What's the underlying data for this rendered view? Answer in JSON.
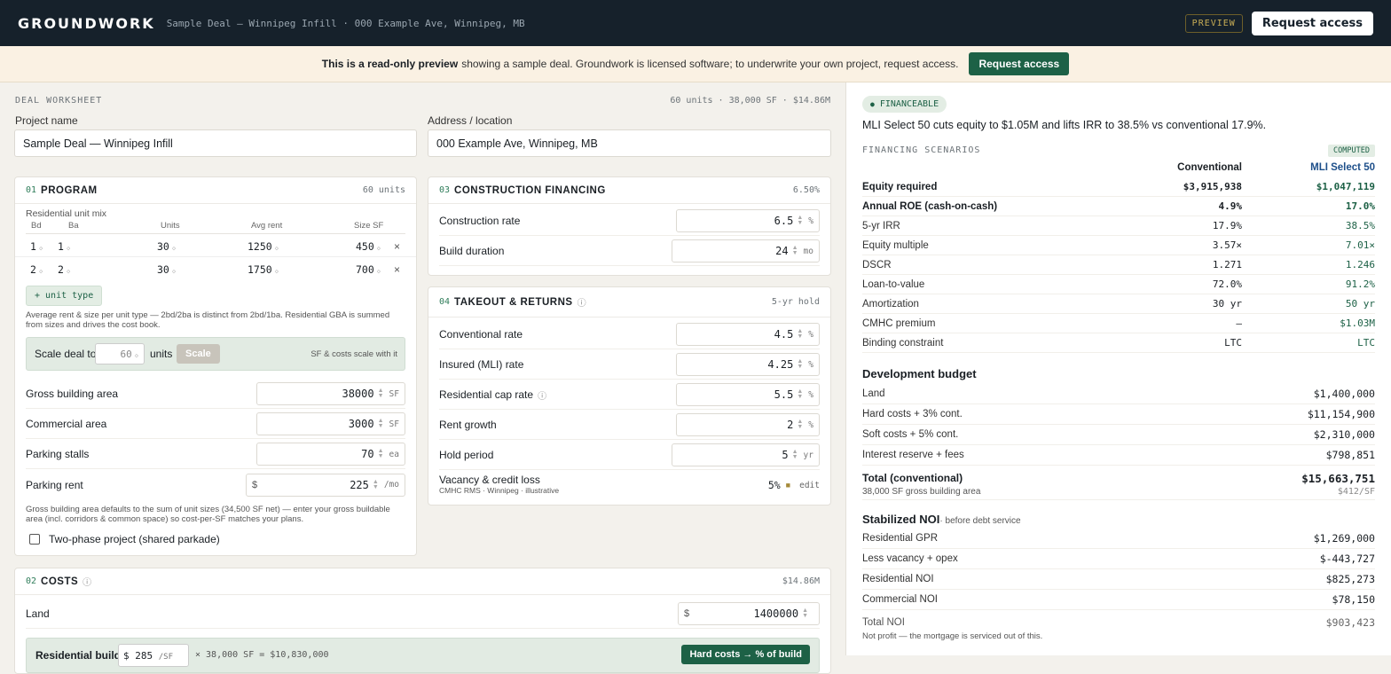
{
  "header": {
    "brand": "GROUNDWORK",
    "breadcrumb": "Sample Deal — Winnipeg Infill · 000 Example Ave, Winnipeg, MB",
    "preview_badge": "PREVIEW",
    "request_label": "Request access"
  },
  "banner": {
    "bold": "This is a read-only preview",
    "text": "showing a sample deal. Groundwork is licensed software; to underwrite your own project, request access.",
    "button": "Request access"
  },
  "worksheet": {
    "label": "DEAL WORKSHEET",
    "summary": "60 units · 38,000 SF · $14.86M",
    "project_label": "Project name",
    "project_value": "Sample Deal — Winnipeg Infill",
    "address_label": "Address / location",
    "address_value": "000 Example Ave, Winnipeg, MB"
  },
  "program": {
    "num": "01",
    "title": "PROGRAM",
    "meta": "60 units",
    "mix_label": "Residential unit mix",
    "col_bd": "Bd",
    "col_ba": "Ba",
    "col_units": "Units",
    "col_rent": "Avg rent",
    "col_size": "Size SF",
    "rows": [
      {
        "bd": "1",
        "ba": "1",
        "units": "30",
        "rent": "1250",
        "size": "450"
      },
      {
        "bd": "2",
        "ba": "2",
        "units": "30",
        "rent": "1750",
        "size": "700"
      }
    ],
    "add_unit": "+ unit type",
    "mix_note": "Average rent & size per unit type — 2bd/2ba is distinct from 2bd/1ba. Residential GBA is summed from sizes and drives the cost book.",
    "scale_label": "Scale deal to",
    "scale_value": "60",
    "scale_units": "units",
    "scale_button": "Scale",
    "scale_note": "SF & costs scale with it",
    "gba_label": "Gross building area",
    "gba_value": "38000",
    "gba_unit": "SF",
    "comm_label": "Commercial area",
    "comm_value": "3000",
    "comm_unit": "SF",
    "parking_label": "Parking stalls",
    "parking_value": "70",
    "parking_unit": "ea",
    "prent_label": "Parking rent",
    "prent_prefix": "$",
    "prent_value": "225",
    "prent_unit": "/mo",
    "gba_note": "Gross building area defaults to the sum of unit sizes (34,500 SF net) — enter your gross buildable area (incl. corridors & common space) so cost-per-SF matches your plans.",
    "two_phase": "Two-phase project (shared parkade)"
  },
  "construction": {
    "num": "03",
    "title": "CONSTRUCTION FINANCING",
    "meta": "6.50%",
    "rate_label": "Construction rate",
    "rate_value": "6.5",
    "rate_unit": "%",
    "dur_label": "Build duration",
    "dur_value": "24",
    "dur_unit": "mo"
  },
  "takeout": {
    "num": "04",
    "title": "TAKEOUT & RETURNS",
    "meta": "5-yr hold",
    "conv_label": "Conventional rate",
    "conv_value": "4.5",
    "mli_label": "Insured (MLI) rate",
    "mli_value": "4.25",
    "cap_label": "Residential cap rate",
    "cap_value": "5.5",
    "growth_label": "Rent growth",
    "growth_value": "2",
    "hold_label": "Hold period",
    "hold_value": "5",
    "hold_unit": "yr",
    "pct": "%",
    "vac_label": "Vacancy & credit loss",
    "vac_sub": "CMHC RMS · Winnipeg · illustrative",
    "vac_value": "5%",
    "vac_edit": "edit"
  },
  "costs": {
    "num": "02",
    "title": "COSTS",
    "meta": "$14.86M",
    "land_label": "Land",
    "land_prefix": "$",
    "land_value": "1400000",
    "res_label": "Residential build",
    "res_prefix": "$",
    "res_value": "285",
    "res_unit": "/SF",
    "res_calc": "× 38,000 SF = $10,830,000",
    "hard_button": "Hard costs → % of build"
  },
  "results": {
    "badge": "FINANCEABLE",
    "headline": "MLI Select 50 cuts equity to $1.05M and lifts IRR to 38.5% vs conventional 17.9%.",
    "scenarios_label": "FINANCING SCENARIOS",
    "computed": "COMPUTED",
    "col_conv": "Conventional",
    "col_mli": "MLI Select 50",
    "rows": [
      {
        "k": "Equity required",
        "a": "$3,915,938",
        "b": "$1,047,119",
        "bold": true
      },
      {
        "k": "Annual ROE (cash-on-cash)",
        "a": "4.9%",
        "b": "17.0%",
        "bold": true
      },
      {
        "k": "5-yr IRR",
        "a": "17.9%",
        "b": "38.5%"
      },
      {
        "k": "Equity multiple",
        "a": "3.57×",
        "b": "7.01×"
      },
      {
        "k": "DSCR",
        "a": "1.271",
        "b": "1.246"
      },
      {
        "k": "Loan-to-value",
        "a": "72.0%",
        "b": "91.2%"
      },
      {
        "k": "Amortization",
        "a": "30 yr",
        "b": "50 yr"
      },
      {
        "k": "CMHC premium",
        "a": "—",
        "b": "$1.03M"
      },
      {
        "k": "Binding constraint",
        "a": "LTC",
        "b": "LTC"
      }
    ],
    "budget_title": "Development budget",
    "budget": [
      {
        "k": "Land",
        "v": "$1,400,000"
      },
      {
        "k": "Hard costs + 3% cont.",
        "v": "$11,154,900"
      },
      {
        "k": "Soft costs + 5% cont.",
        "v": "$2,310,000"
      },
      {
        "k": "Interest reserve + fees",
        "v": "$798,851"
      }
    ],
    "total_label": "Total (conventional)",
    "total_value": "$15,663,751",
    "total_sub": "38,000 SF gross building area",
    "total_psf": "$412/SF",
    "noi_title": "Stabilized NOI",
    "noi_sub": "· before debt service",
    "noi": [
      {
        "k": "Residential GPR",
        "v": "$1,269,000"
      },
      {
        "k": "Less vacancy + opex",
        "v": "$-443,727"
      },
      {
        "k": "Residential NOI",
        "v": "$825,273"
      },
      {
        "k": "Commercial NOI",
        "v": "$78,150"
      }
    ],
    "total_noi_label": "Total NOI",
    "total_noi_value": "$903,423",
    "noi_note": "Not profit — the mortgage is serviced out of this."
  }
}
